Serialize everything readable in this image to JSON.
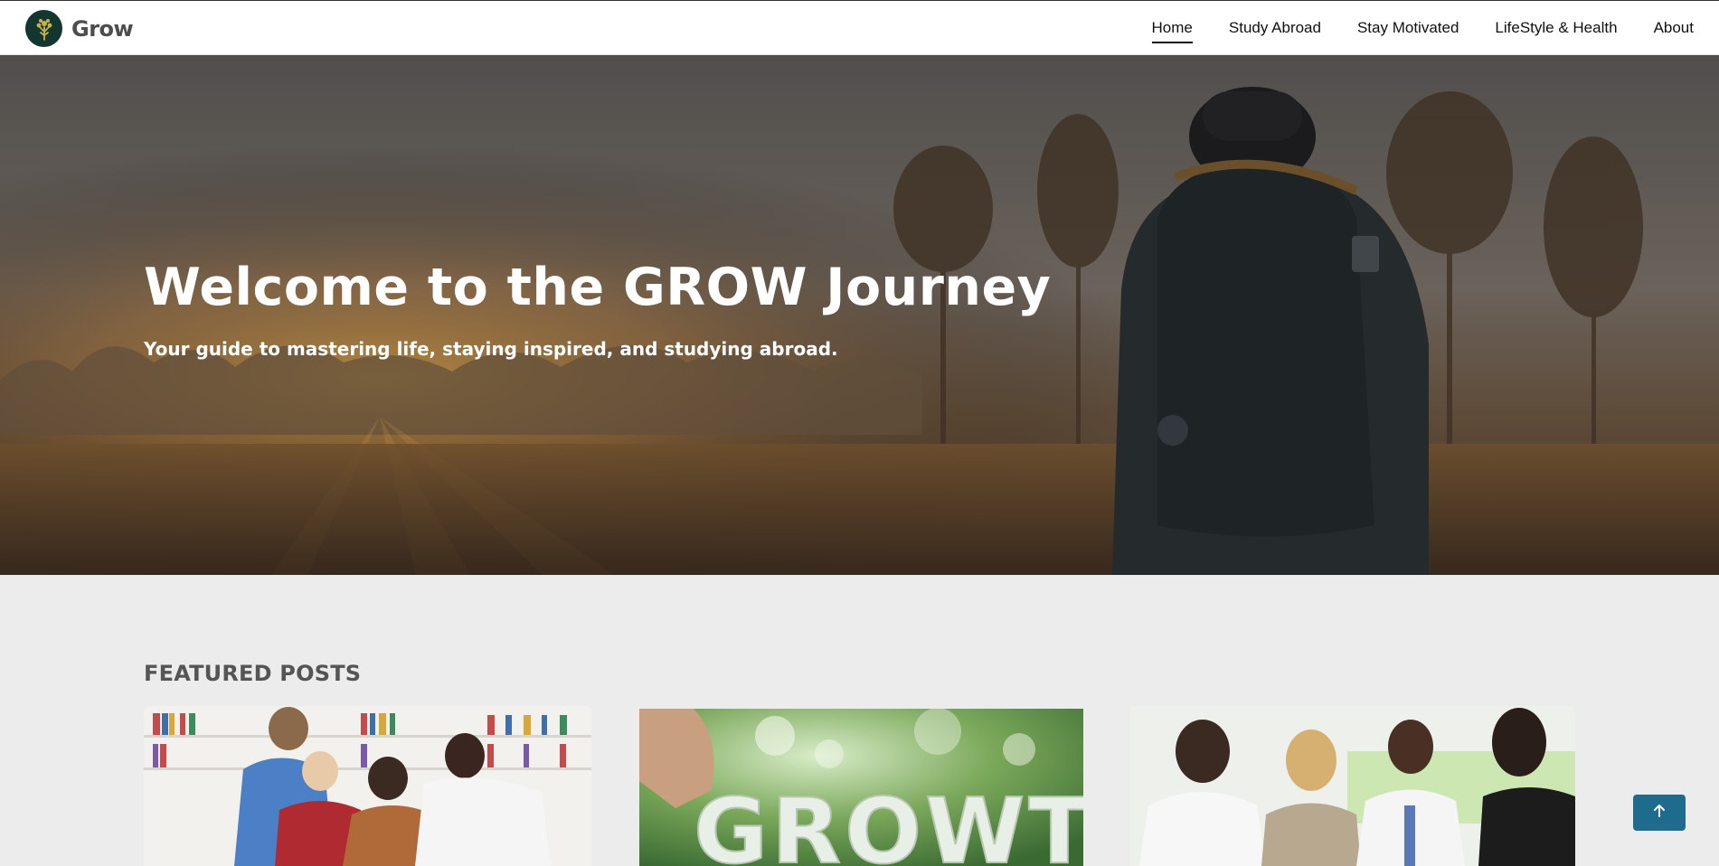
{
  "brand": {
    "name": "Grow",
    "logo_icon": "tree-icon"
  },
  "nav": {
    "items": [
      {
        "label": "Home",
        "active": true
      },
      {
        "label": "Study Abroad",
        "active": false
      },
      {
        "label": "Stay Motivated",
        "active": false
      },
      {
        "label": "LifeStyle & Health",
        "active": false
      },
      {
        "label": "About",
        "active": false
      }
    ]
  },
  "hero": {
    "title": "Welcome to the GROW Journey",
    "subtitle": "Your guide to mastering life, staying inspired, and studying abroad."
  },
  "featured": {
    "heading": "FEATURED POSTS",
    "cards": [
      {
        "image_alt": "students studying together in a library"
      },
      {
        "image_alt": "hand placing GROWTH letters",
        "image_text": "GROWTH"
      },
      {
        "image_alt": "group of professionals in a discussion"
      }
    ]
  },
  "scroll_top": {
    "icon": "arrow-up-icon"
  },
  "colors": {
    "logo_bg": "#13372f",
    "brand_text": "#4d4d4d",
    "scroll_button": "#1f6b8e",
    "page_bg": "#ececec"
  }
}
